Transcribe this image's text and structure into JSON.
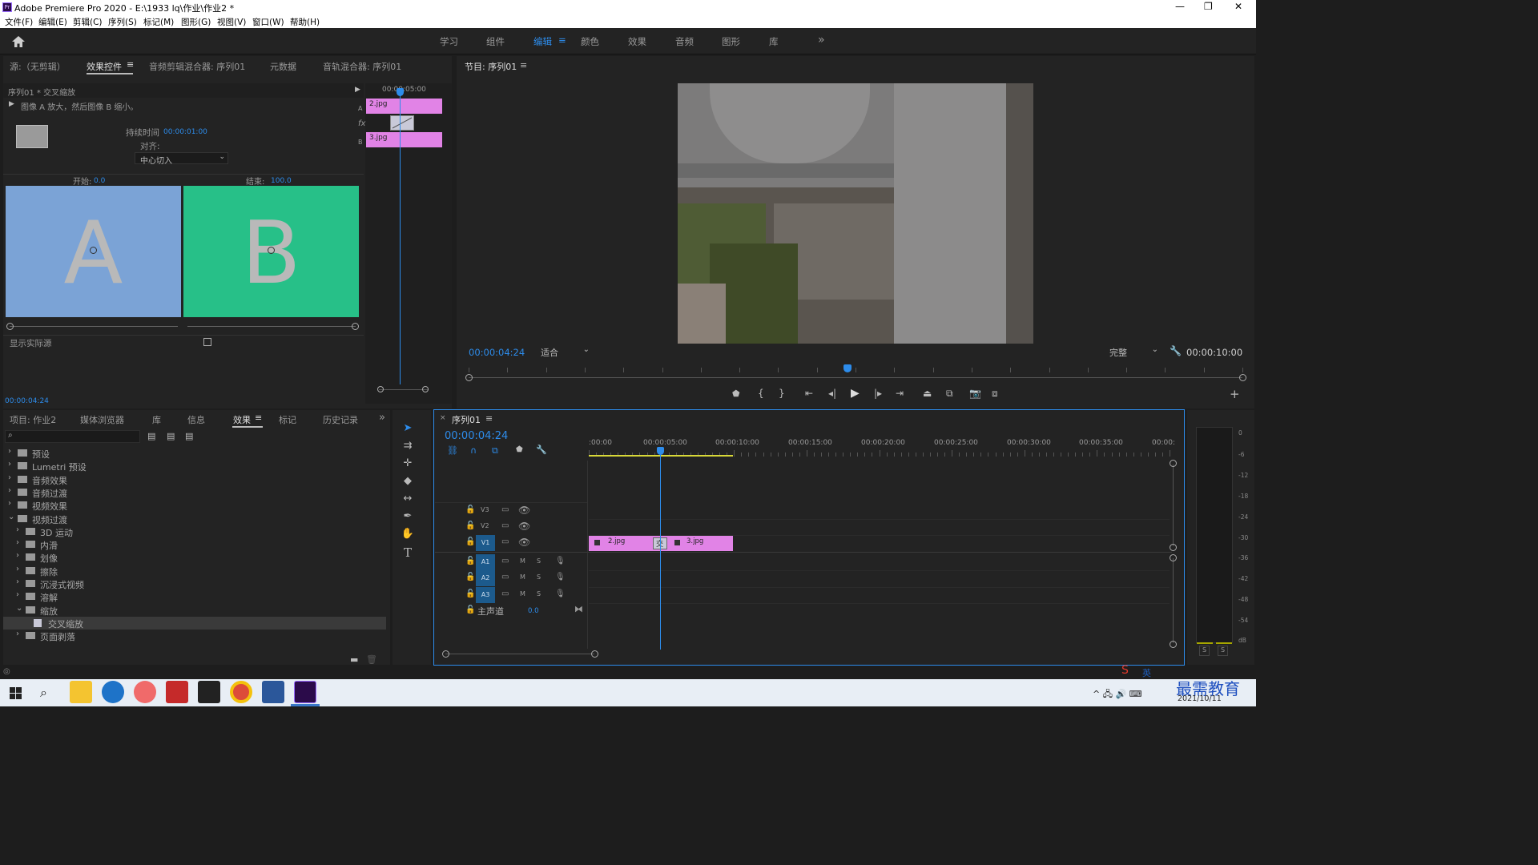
{
  "window": {
    "title": "Adobe Premiere Pro 2020 - E:\\1933 lq\\作业\\作业2 *",
    "app_icon": "Pr",
    "minimize": "—",
    "maximize": "❐",
    "close": "✕"
  },
  "menu": [
    "文件(F)",
    "编辑(E)",
    "剪辑(C)",
    "序列(S)",
    "标记(M)",
    "图形(G)",
    "视图(V)",
    "窗口(W)",
    "帮助(H)"
  ],
  "workspaces": [
    "学习",
    "组件",
    "编辑",
    "颜色",
    "效果",
    "音频",
    "图形",
    "库"
  ],
  "workspace_more": "»",
  "source_panel": {
    "tabs": [
      "源:（无剪辑）",
      "效果控件",
      "音频剪辑混合器: 序列01",
      "元数据",
      "音轨混合器: 序列01"
    ],
    "active_tab": "效果控件",
    "clip_header": "序列01 * 交叉缩放",
    "description": "图像 A 放大，然后图像 B 缩小。",
    "duration_label": "持续时间",
    "duration_value": "00:00:01:00",
    "align_label": "对齐:",
    "align_value": "中心切入",
    "start_label": "开始:",
    "start_value": "0.0",
    "end_label": "结束:",
    "end_value": "100.0",
    "preview_a_letter": "A",
    "preview_b_letter": "B",
    "preview_a_color": "#7ba3d6",
    "preview_b_color": "#27c088",
    "show_actual_sources": "显示实际源",
    "mini_timecode": "00:00:05:00",
    "track_a_label": "A",
    "track_b_label": "B",
    "fx_label": "fx",
    "clip_a": "2.jpg",
    "clip_b": "3.jpg",
    "current_time": "00:00:04:24"
  },
  "program_monitor": {
    "title": "节目: 序列01",
    "timecode": "00:00:04:24",
    "fit": "适合",
    "quality": "完整",
    "duration": "00:00:10:00",
    "playhead_fraction": 0.49
  },
  "project_panel": {
    "tabs": [
      "项目: 作业2",
      "媒体浏览器",
      "库",
      "信息",
      "效果",
      "标记",
      "历史记录"
    ],
    "active_tab": "效果",
    "more": "»",
    "search_placeholder": "",
    "tree": [
      {
        "label": "预设",
        "level": 0,
        "expanded": false
      },
      {
        "label": "Lumetri 预设",
        "level": 0,
        "expanded": false
      },
      {
        "label": "音频效果",
        "level": 0,
        "expanded": false
      },
      {
        "label": "音频过渡",
        "level": 0,
        "expanded": false
      },
      {
        "label": "视频效果",
        "level": 0,
        "expanded": false
      },
      {
        "label": "视频过渡",
        "level": 0,
        "expanded": true
      },
      {
        "label": "3D 运动",
        "level": 1,
        "expanded": false
      },
      {
        "label": "内滑",
        "level": 1,
        "expanded": false
      },
      {
        "label": "划像",
        "level": 1,
        "expanded": false
      },
      {
        "label": "擦除",
        "level": 1,
        "expanded": false
      },
      {
        "label": "沉浸式视频",
        "level": 1,
        "expanded": false
      },
      {
        "label": "溶解",
        "level": 1,
        "expanded": false
      },
      {
        "label": "缩放",
        "level": 1,
        "expanded": true
      },
      {
        "label": "交叉缩放",
        "level": 2,
        "selected": true
      },
      {
        "label": "页面剥落",
        "level": 1,
        "expanded": false
      }
    ]
  },
  "timeline": {
    "title": "序列01",
    "timecode": "00:00:04:24",
    "ruler": [
      ":00:00",
      "00:00:05:00",
      "00:00:10:00",
      "00:00:15:00",
      "00:00:20:00",
      "00:00:25:00",
      "00:00:30:00",
      "00:00:35:00",
      "00:00:"
    ],
    "video_tracks": [
      "V3",
      "V2",
      "V1"
    ],
    "audio_tracks": [
      "A1",
      "A2",
      "A3"
    ],
    "master_label": "主声道",
    "master_value": "0.0",
    "mute": "M",
    "solo": "S",
    "clip_1": "2.jpg",
    "clip_2": "3.jpg",
    "transition_label": "交",
    "clip_color": "#e183e6"
  },
  "audio_meter": {
    "labels": [
      "0",
      "-6",
      "-12",
      "-18",
      "-24",
      "-30",
      "-36",
      "-42",
      "-48",
      "-54",
      "dB"
    ],
    "solo_left": "S",
    "solo_right": "S"
  },
  "taskbar": {
    "ime": "英",
    "watermark": "最需教育",
    "date": "2021/10/11"
  },
  "colors": {
    "accent": "#2d8ceb",
    "clip": "#e183e6",
    "panel": "#232323"
  }
}
